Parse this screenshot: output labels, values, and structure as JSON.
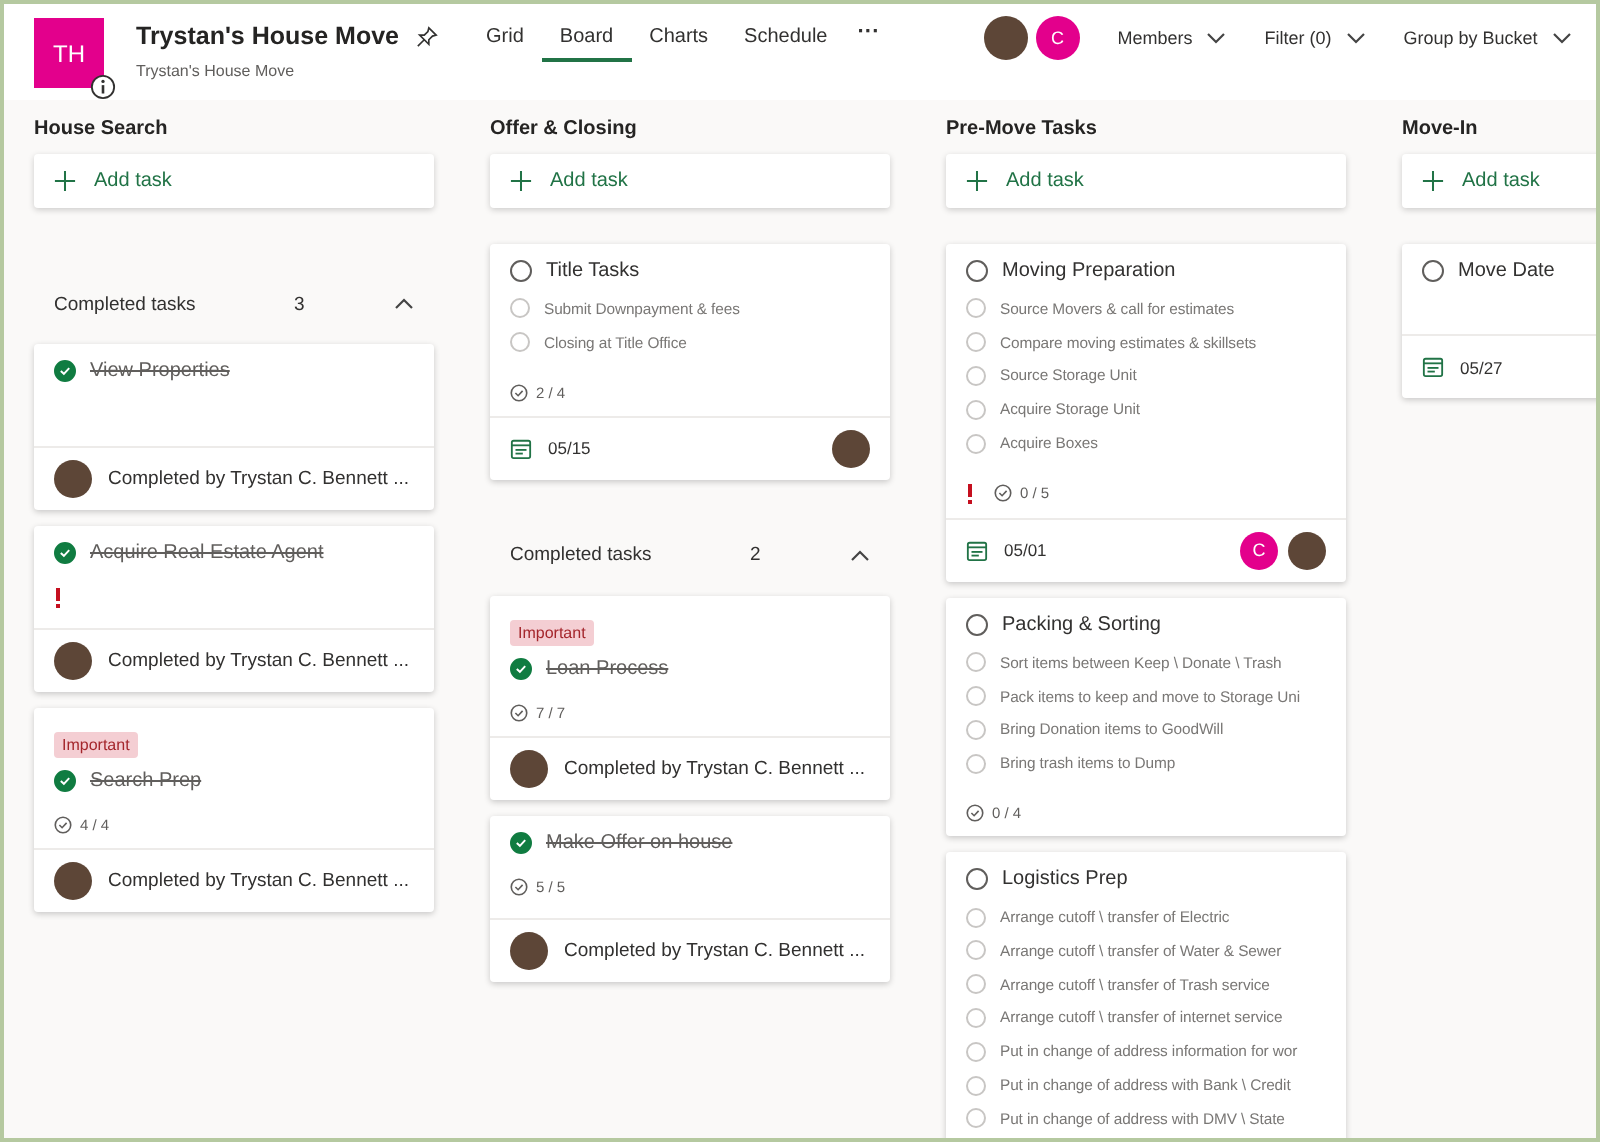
{
  "plan": {
    "initials": "TH",
    "title": "Trystan's House Move",
    "subtitle": "Trystan's House Move"
  },
  "tabs": [
    {
      "label": "Grid",
      "selected": false
    },
    {
      "label": "Board",
      "selected": true
    },
    {
      "label": "Charts",
      "selected": false
    },
    {
      "label": "Schedule",
      "selected": false
    }
  ],
  "more": "···",
  "members": [
    {
      "kind": "photo"
    },
    {
      "kind": "initial",
      "text": "C"
    }
  ],
  "menus": [
    "Members",
    "Filter (0)",
    "Group by Bucket"
  ],
  "buckets": [
    {
      "name": "House Search",
      "add_label": "Add task",
      "completed": {
        "label": "Completed tasks",
        "count": "3",
        "expanded": true,
        "tasks": [
          {
            "title": "View Properties",
            "done": true,
            "completed_by": "Completed by Trystan C. Bennett ..."
          },
          {
            "title": "Acquire Real Estate Agent",
            "done": true,
            "important": true,
            "completed_by": "Completed by Trystan C. Bennett ..."
          },
          {
            "tag": "Important",
            "title": "Search Prep",
            "done": true,
            "progress": "4 / 4",
            "completed_by": "Completed by Trystan C. Bennett ..."
          }
        ]
      }
    },
    {
      "name": "Offer & Closing",
      "add_label": "Add task",
      "tasks": [
        {
          "title": "Title Tasks",
          "done": false,
          "checklist": [
            {
              "text": "Submit Downpayment & fees",
              "checked": false
            },
            {
              "text": "Closing at Title Office",
              "checked": false
            }
          ],
          "progress": "2 / 4",
          "due": "05/15",
          "assignees": [
            {
              "kind": "photo"
            }
          ]
        }
      ],
      "completed": {
        "label": "Completed tasks",
        "count": "2",
        "expanded": true,
        "tasks": [
          {
            "tag": "Important",
            "title": "Loan Process",
            "done": true,
            "progress": "7 / 7",
            "completed_by": "Completed by Trystan C. Bennett ..."
          },
          {
            "title": "Make Offer on house",
            "done": true,
            "progress": "5 / 5",
            "completed_by": "Completed by Trystan C. Bennett ..."
          }
        ]
      }
    },
    {
      "name": "Pre-Move Tasks",
      "add_label": "Add task",
      "tasks": [
        {
          "title": "Moving Preparation",
          "done": false,
          "checklist": [
            {
              "text": "Source Movers & call for estimates",
              "checked": false
            },
            {
              "text": "Compare moving estimates & skillsets",
              "checked": false
            },
            {
              "text": "Source Storage Unit",
              "checked": false
            },
            {
              "text": "Acquire Storage Unit",
              "checked": false
            },
            {
              "text": "Acquire Boxes",
              "checked": false
            }
          ],
          "important": true,
          "progress": "0 / 5",
          "due": "05/01",
          "assignees": [
            {
              "kind": "initial",
              "text": "C"
            },
            {
              "kind": "photo"
            }
          ]
        },
        {
          "title": "Packing & Sorting",
          "done": false,
          "checklist": [
            {
              "text": "Sort items between Keep \\ Donate \\ Trash",
              "checked": false
            },
            {
              "text": "Pack items to keep and move to Storage Uni",
              "checked": false
            },
            {
              "text": "Bring Donation items to GoodWill",
              "checked": false
            },
            {
              "text": "Bring trash items to Dump",
              "checked": false
            }
          ],
          "progress": "0 / 4"
        },
        {
          "title": "Logistics Prep",
          "done": false,
          "checklist": [
            {
              "text": "Arrange cutoff \\ transfer of Electric",
              "checked": false
            },
            {
              "text": "Arrange cutoff \\ transfer of Water & Sewer",
              "checked": false
            },
            {
              "text": "Arrange cutoff \\ transfer of Trash service",
              "checked": false
            },
            {
              "text": "Arrange cutoff \\ transfer of internet service",
              "checked": false
            },
            {
              "text": "Put in change of address information for wor",
              "checked": false
            },
            {
              "text": "Put in change of address with Bank \\ Credit",
              "checked": false
            },
            {
              "text": "Put in change of address with DMV \\ State",
              "checked": false
            }
          ]
        }
      ]
    },
    {
      "name": "Move-In",
      "add_label": "Add task",
      "tasks": [
        {
          "title": "Move Date",
          "done": false,
          "due": "05/27"
        }
      ]
    }
  ]
}
